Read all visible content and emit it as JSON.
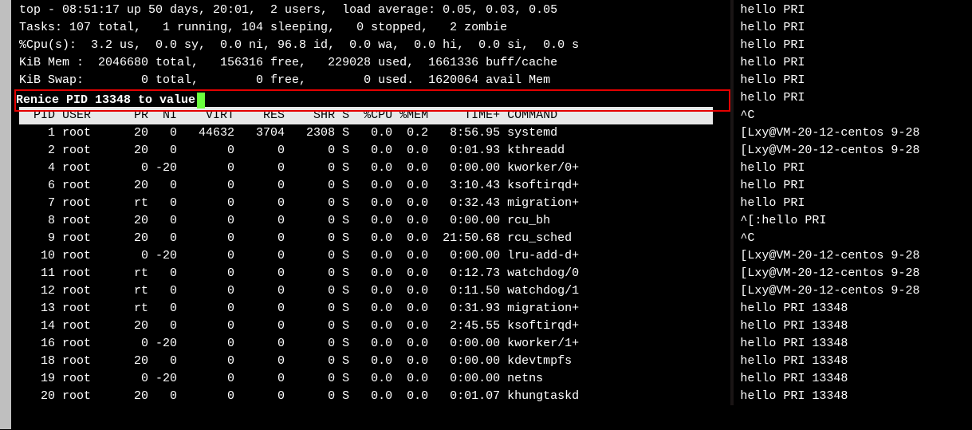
{
  "top": {
    "line1": "top - 08:51:17 up 50 days, 20:01,  2 users,  load average: 0.05, 0.03, 0.05",
    "line2": "Tasks: 107 total,   1 running, 104 sleeping,   0 stopped,   2 zombie",
    "line3": "%Cpu(s):  3.2 us,  0.0 sy,  0.0 ni, 96.8 id,  0.0 wa,  0.0 hi,  0.0 si,  0.0 s",
    "line4": "KiB Mem :  2046680 total,   156316 free,   229028 used,  1661336 buff/cache",
    "line5": "KiB Swap:        0 total,        0 free,        0 used.  1620064 avail Mem"
  },
  "renice": {
    "label": "Renice PID 13348 to value"
  },
  "cols": "  PID USER      PR  NI    VIRT    RES    SHR S  %CPU %MEM     TIME+ COMMAND   ",
  "procs": [
    "    1 root      20   0   44632   3704   2308 S   0.0  0.2   8:56.95 systemd   ",
    "    2 root      20   0       0      0      0 S   0.0  0.0   0:01.93 kthreadd  ",
    "    4 root       0 -20       0      0      0 S   0.0  0.0   0:00.00 kworker/0+",
    "    6 root      20   0       0      0      0 S   0.0  0.0   3:10.43 ksoftirqd+",
    "    7 root      rt   0       0      0      0 S   0.0  0.0   0:32.43 migration+",
    "    8 root      20   0       0      0      0 S   0.0  0.0   0:00.00 rcu_bh    ",
    "    9 root      20   0       0      0      0 S   0.0  0.0  21:50.68 rcu_sched ",
    "   10 root       0 -20       0      0      0 S   0.0  0.0   0:00.00 lru-add-d+",
    "   11 root      rt   0       0      0      0 S   0.0  0.0   0:12.73 watchdog/0",
    "   12 root      rt   0       0      0      0 S   0.0  0.0   0:11.50 watchdog/1",
    "   13 root      rt   0       0      0      0 S   0.0  0.0   0:31.93 migration+",
    "   14 root      20   0       0      0      0 S   0.0  0.0   2:45.55 ksoftirqd+",
    "   16 root       0 -20       0      0      0 S   0.0  0.0   0:00.00 kworker/1+",
    "   18 root      20   0       0      0      0 S   0.0  0.0   0:00.00 kdevtmpfs ",
    "   19 root       0 -20       0      0      0 S   0.0  0.0   0:00.00 netns     ",
    "   20 root      20   0       0      0      0 S   0.0  0.0   0:01.07 khungtaskd"
  ],
  "right_lines": [
    "hello PRI",
    "hello PRI",
    "hello PRI",
    "hello PRI",
    "hello PRI",
    "hello PRI",
    "^C",
    "[Lxy@VM-20-12-centos 9-28",
    "[Lxy@VM-20-12-centos 9-28",
    "hello PRI",
    "hello PRI",
    "hello PRI",
    "^[:hello PRI",
    "^C",
    "[Lxy@VM-20-12-centos 9-28",
    "[Lxy@VM-20-12-centos 9-28",
    "[Lxy@VM-20-12-centos 9-28",
    "hello PRI 13348",
    "hello PRI 13348",
    "hello PRI 13348",
    "hello PRI 13348",
    "hello PRI 13348",
    "hello PRI 13348"
  ]
}
